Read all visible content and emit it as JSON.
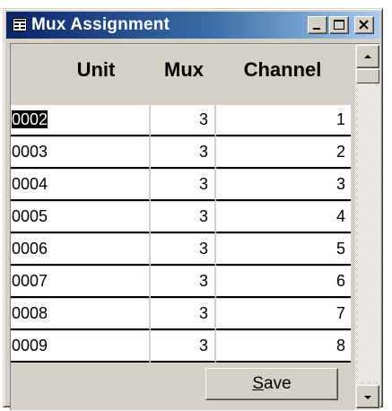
{
  "window": {
    "title": "Mux Assignment",
    "icon": "form-window-icon",
    "controls": [
      "minimize-icon",
      "maximize-icon",
      "close-icon"
    ]
  },
  "grid": {
    "columns": [
      "Unit",
      "Mux",
      "Channel"
    ],
    "rows": [
      {
        "unit": "0002",
        "mux": "3",
        "channel": "1"
      },
      {
        "unit": "0003",
        "mux": "3",
        "channel": "2"
      },
      {
        "unit": "0004",
        "mux": "3",
        "channel": "3"
      },
      {
        "unit": "0005",
        "mux": "3",
        "channel": "4"
      },
      {
        "unit": "0006",
        "mux": "3",
        "channel": "5"
      },
      {
        "unit": "0007",
        "mux": "3",
        "channel": "6"
      },
      {
        "unit": "0008",
        "mux": "3",
        "channel": "7"
      },
      {
        "unit": "0009",
        "mux": "3",
        "channel": "8"
      }
    ],
    "selected_row": 0
  },
  "footer": {
    "save_label_mnemonic": "S",
    "save_label_rest": "ave"
  },
  "colors": {
    "title_start": "#0a246a",
    "title_end": "#a6caf0",
    "face": "#d4d0c8"
  }
}
